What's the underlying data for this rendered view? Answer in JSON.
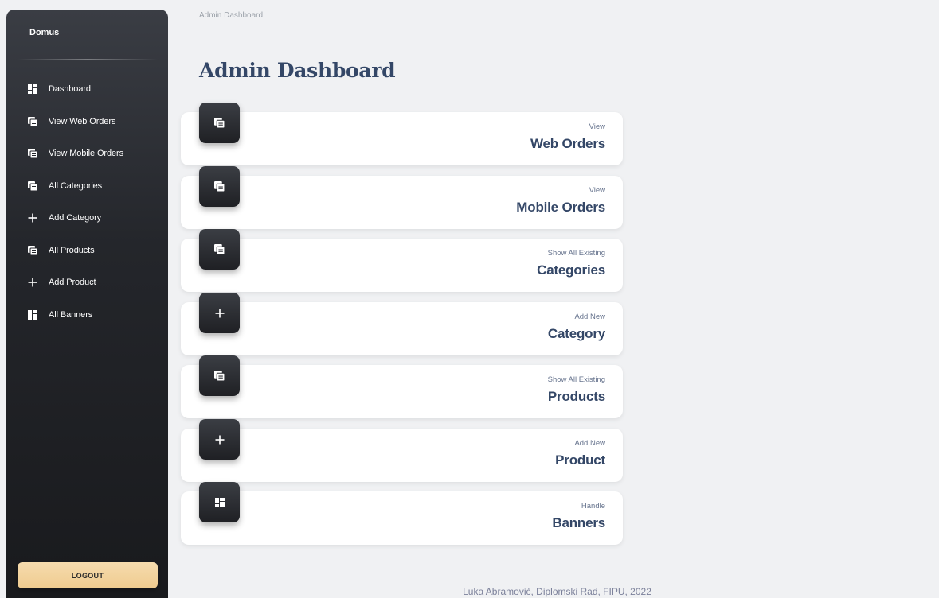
{
  "sidebar": {
    "brand": "Domus",
    "items": [
      {
        "label": "Dashboard",
        "icon": "dashboard-icon"
      },
      {
        "label": "View Web Orders",
        "icon": "copy-icon"
      },
      {
        "label": "View Mobile Orders",
        "icon": "copy-icon"
      },
      {
        "label": "All Categories",
        "icon": "copy-icon"
      },
      {
        "label": "Add Category",
        "icon": "plus-icon"
      },
      {
        "label": "All Products",
        "icon": "copy-icon"
      },
      {
        "label": "Add Product",
        "icon": "plus-icon"
      },
      {
        "label": "All Banners",
        "icon": "dashboard-icon"
      }
    ],
    "logout_label": "LOGOUT"
  },
  "breadcrumb": "Admin Dashboard",
  "page_title": "Admin Dashboard",
  "cards": [
    {
      "subtitle": "View",
      "title": "Web Orders",
      "icon": "copy-icon"
    },
    {
      "subtitle": "View",
      "title": "Mobile Orders",
      "icon": "copy-icon"
    },
    {
      "subtitle": "Show All Existing",
      "title": "Categories",
      "icon": "copy-icon"
    },
    {
      "subtitle": "Add New",
      "title": "Category",
      "icon": "plus-icon"
    },
    {
      "subtitle": "Show All Existing",
      "title": "Products",
      "icon": "copy-icon"
    },
    {
      "subtitle": "Add New",
      "title": "Product",
      "icon": "plus-icon"
    },
    {
      "subtitle": "Handle",
      "title": "Banners",
      "icon": "dashboard-icon"
    }
  ],
  "footer": "Luka Abramović, Diplomski Rad, FIPU, 2022",
  "colors": {
    "accent": "#344767",
    "logout": "#efcb8f",
    "sidebar": "#1f2024",
    "background": "#f0f1f3"
  }
}
